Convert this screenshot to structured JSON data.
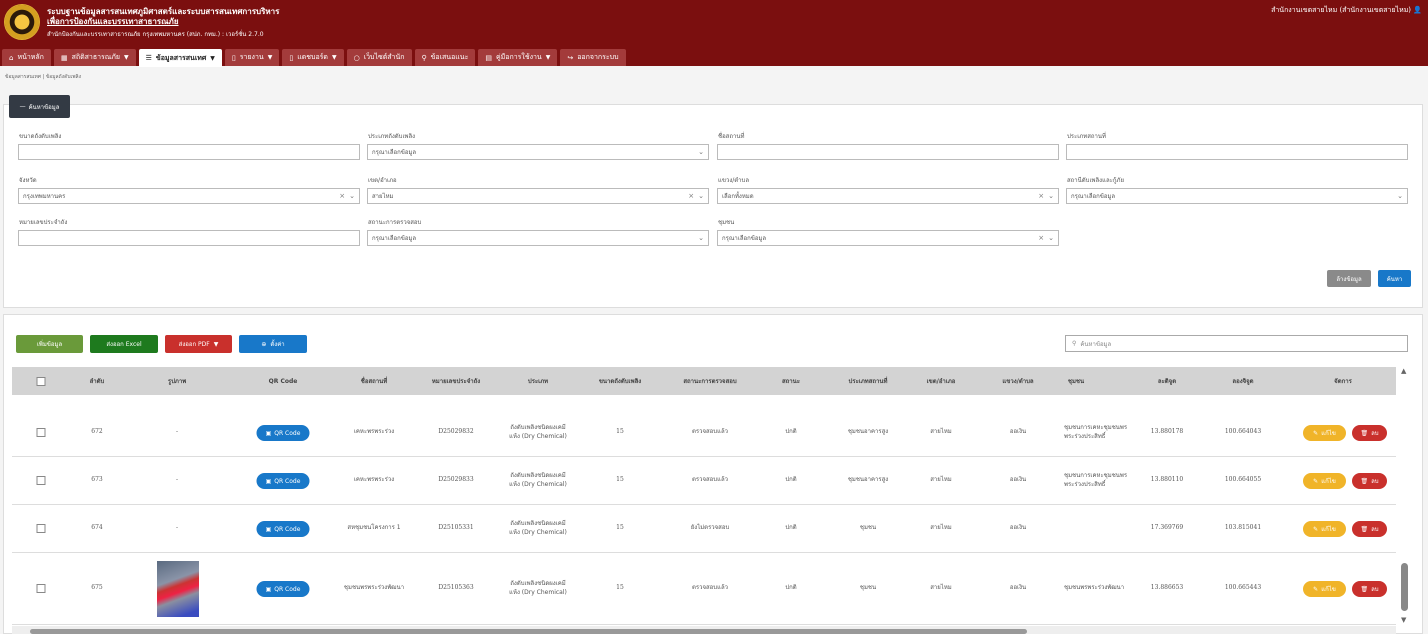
{
  "header": {
    "title_line1": "ระบบฐานข้อมูลสารสนเทศภูมิศาสตร์และระบบสารสนเทศการบริหาร",
    "title_line2": "เพื่อการป้องกันและบรรเทาสาธารณภัย",
    "title_line3": "สำนักป้องกันและบรรเทาสาธารณภัย กรุงเทพมหานคร (สปภ. กทม.) : เวอร์ชั่น 2.7.0",
    "user": "สำนักงานเขตสายไหม (สำนักงานเขตสายไหม)"
  },
  "nav": [
    {
      "label": "หน้าหลัก",
      "icon": "home-icon"
    },
    {
      "label": "สถิติสาธารณภัย",
      "icon": "chart-icon"
    },
    {
      "label": "ข้อมูลสารสนเทศ",
      "icon": "list-icon"
    },
    {
      "label": "รายงาน",
      "icon": "file-icon"
    },
    {
      "label": "แดชบอร์ด",
      "icon": "file-icon"
    },
    {
      "label": "เว็บไซต์สำนัก",
      "icon": "globe-icon"
    },
    {
      "label": "ข้อเสนอแนะ",
      "icon": "search-icon"
    },
    {
      "label": "คู่มือการใช้งาน",
      "icon": "book-icon"
    },
    {
      "label": "ออกจากระบบ",
      "icon": "logout-icon"
    }
  ],
  "breadcrumb": "ข้อมูลสารสนเทศ | ข้อมูลถังดับเพลิง",
  "search": {
    "toggle_label": "ค้นหาข้อมูล",
    "fields": {
      "size": {
        "label": "ขนาดถังดับเพลิง",
        "value": ""
      },
      "type": {
        "label": "ประเภทถังดับเพลิง",
        "value": "กรุณาเลือกข้อมูล"
      },
      "place_name": {
        "label": "ชื่อสถานที่",
        "value": ""
      },
      "place_type": {
        "label": "ประเภทสถานที่",
        "value": ""
      },
      "province": {
        "label": "จังหวัด",
        "value": "กรุงเทพมหานคร"
      },
      "district": {
        "label": "เขต/อำเภอ",
        "value": "สายไหม"
      },
      "subdistrict": {
        "label": "แขวง/ตำบล",
        "value": "เลือกทั้งหมด"
      },
      "station": {
        "label": "สถานีดับเพลิงและกู้ภัย",
        "value": "กรุณาเลือกข้อมูล"
      },
      "serial": {
        "label": "หมายเลขประจำถัง",
        "value": ""
      },
      "inspection": {
        "label": "สถานะการตรวจสอบ",
        "value": "กรุณาเลือกข้อมูล"
      },
      "community": {
        "label": "ชุมชน",
        "value": "กรุณาเลือกข้อมูล"
      }
    },
    "clear_label": "ล้างข้อมูล",
    "search_label": "ค้นหา"
  },
  "toolbar": {
    "add_label": "เพิ่มข้อมูล",
    "excel_label": "ส่งออก Excel",
    "pdf_label": "ส่งออก PDF",
    "settings_label": "ตั้งค่า",
    "search_placeholder": "ค้นหาข้อมูล"
  },
  "table": {
    "columns": [
      "ลำดับ",
      "รูปภาพ",
      "QR Code",
      "ชื่อสถานที่",
      "หมายเลขประจำถัง",
      "ประเภท",
      "ขนาดถังดับเพลิง",
      "สถานะการตรวจสอบ",
      "สถานะ",
      "ประเภทสถานที่",
      "เขต/อำเภอ",
      "แขวง/ตำบล",
      "ชุมชน",
      "ละติจูด",
      "ลองจิจูด",
      "จัดการ"
    ],
    "qr_label": "QR Code",
    "edit_label": "แก้ไข",
    "delete_label": "ลบ",
    "rows": [
      {
        "no": "672",
        "image": "-",
        "place": "เคหะพรพระร่วง",
        "serial": "D25029832",
        "type": "ถังดับเพลิงชนิดผงเคมีแห้ง (Dry Chemical)",
        "size": "15",
        "inspection": "ตรวจสอบแล้ว",
        "status": "ปกติ",
        "place_type": "ชุมชนอาคารสูง",
        "district": "สายไหม",
        "subdistrict": "ออเงิน",
        "community": "ชุมชนการเคหะชุมชนพรพระร่วงประสิทธิ์",
        "lat": "13.880178",
        "lng": "100.664043"
      },
      {
        "no": "673",
        "image": "-",
        "place": "เคหะพรพระร่วง",
        "serial": "D25029833",
        "type": "ถังดับเพลิงชนิดผงเคมีแห้ง (Dry Chemical)",
        "size": "15",
        "inspection": "ตรวจสอบแล้ว",
        "status": "ปกติ",
        "place_type": "ชุมชนอาคารสูง",
        "district": "สายไหม",
        "subdistrict": "ออเงิน",
        "community": "ชุมชนการเคหะชุมชนพรพระร่วงประสิทธิ์",
        "lat": "13.880110",
        "lng": "100.664055"
      },
      {
        "no": "674",
        "image": "-",
        "place": "สหชุมชนโครงการ 1",
        "serial": "D25105331",
        "type": "ถังดับเพลิงชนิดผงเคมีแห้ง (Dry Chemical)",
        "size": "15",
        "inspection": "ยังไม่ตรวจสอบ",
        "status": "ปกติ",
        "place_type": "ชุมชน",
        "district": "สายไหม",
        "subdistrict": "ออเงิน",
        "community": "",
        "lat": "17.369769",
        "lng": "103.815041"
      },
      {
        "no": "675",
        "image": "",
        "place": "ชุมชนพรพระร่วงพัฒนา",
        "serial": "D25105363",
        "type": "ถังดับเพลิงชนิดผงเคมีแห้ง (Dry Chemical)",
        "size": "15",
        "inspection": "ตรวจสอบแล้ว",
        "status": "ปกติ",
        "place_type": "ชุมชน",
        "district": "สายไหม",
        "subdistrict": "ออเงิน",
        "community": "ชุมชนพรพระร่วงพัฒนา",
        "lat": "13.886653",
        "lng": "100.665443"
      }
    ]
  },
  "colors": {
    "header": "#7b0f0f",
    "nav": "#a33b3b",
    "qr": "#1878c9",
    "edit": "#f0b429",
    "delete": "#c9302c",
    "add": "#6a9a3a",
    "excel": "#1e7a1e",
    "pdf": "#c9302c",
    "settings": "#1878c9"
  }
}
